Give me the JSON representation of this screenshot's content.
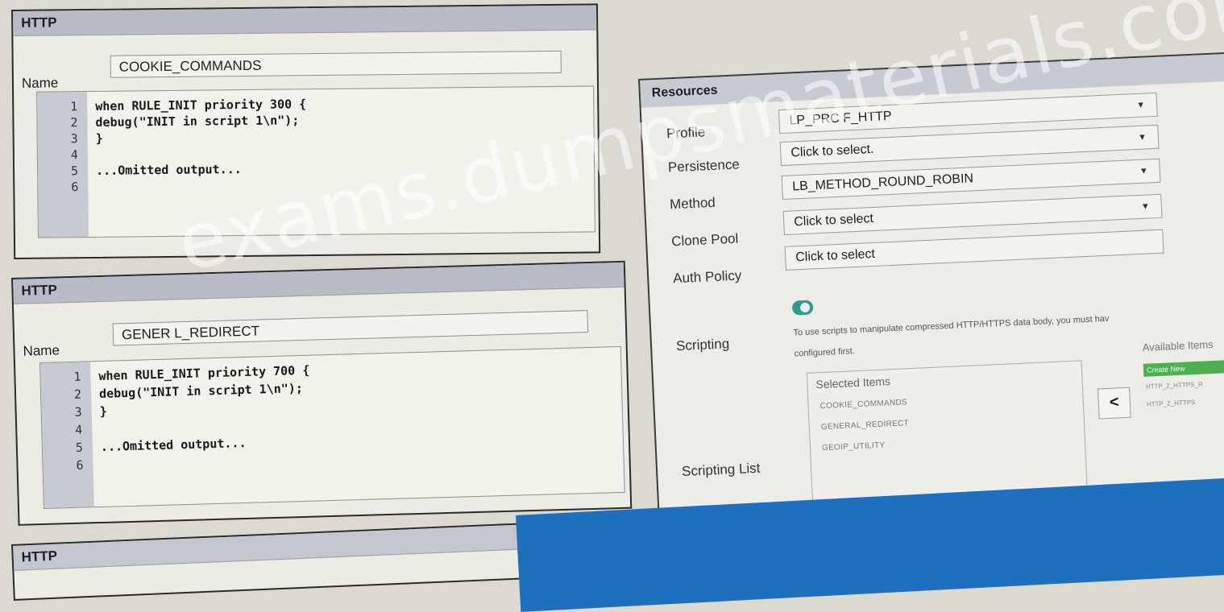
{
  "panels": [
    {
      "header": "HTTP",
      "name_label": "Name",
      "name_value": "COOKIE_COMMANDS",
      "lines": [
        {
          "n": "1",
          "code": "when RULE_INIT priority 300 {"
        },
        {
          "n": "2",
          "code": "debug(\"INIT in script 1\\n\");"
        },
        {
          "n": "3",
          "code": "}"
        },
        {
          "n": "4",
          "code": ""
        },
        {
          "n": "5",
          "code": "...Omitted output..."
        },
        {
          "n": "6",
          "code": ""
        }
      ]
    },
    {
      "header": "HTTP",
      "name_label": "Name",
      "name_value": "GENER L_REDIRECT",
      "lines": [
        {
          "n": "1",
          "code": "when RULE_INIT priority 700 {"
        },
        {
          "n": "2",
          "code": "debug(\"INIT in script 1\\n\");"
        },
        {
          "n": "3",
          "code": "}"
        },
        {
          "n": "4",
          "code": ""
        },
        {
          "n": "5",
          "code": "...Omitted output..."
        },
        {
          "n": "6",
          "code": ""
        }
      ]
    },
    {
      "header": "HTTP"
    }
  ],
  "resources": {
    "header": "Resources",
    "profile": {
      "label": "Profile",
      "value": "LP_PRC F_HTTP"
    },
    "persistence": {
      "label": "Persistence",
      "value": "Click to select."
    },
    "method": {
      "label": "Method",
      "value": "LB_METHOD_ROUND_ROBIN"
    },
    "clone_pool": {
      "label": "Clone Pool",
      "value": "Click to select"
    },
    "auth_policy": {
      "label": "Auth Policy",
      "value": "Click to select"
    },
    "scripting": {
      "label": "Scripting",
      "note1": "To use scripts to manipulate compressed HTTP/HTTPS data body, you must hav",
      "note2": "configured first."
    },
    "scripting_list": {
      "label": "Scripting List",
      "selected_title": "Selected Items",
      "selected": [
        "COOKIE_COMMANDS",
        "GENERAL_REDIRECT",
        "GEOIP_UTILITY"
      ],
      "move_button": "<",
      "available_title": "Available Items",
      "create_new": "Create New",
      "available": [
        "HTTP_2_HTTPS_R",
        "HTTP_2_HTTPS"
      ]
    }
  },
  "watermark": "exams.dumpsmaterials.com",
  "colors": {
    "header_bg": "#b9bcc6",
    "gutter_bg": "#c8cad3",
    "toggle": "#2f9a92",
    "create_new": "#4caf50",
    "taskbar": "#1f6fbf"
  }
}
